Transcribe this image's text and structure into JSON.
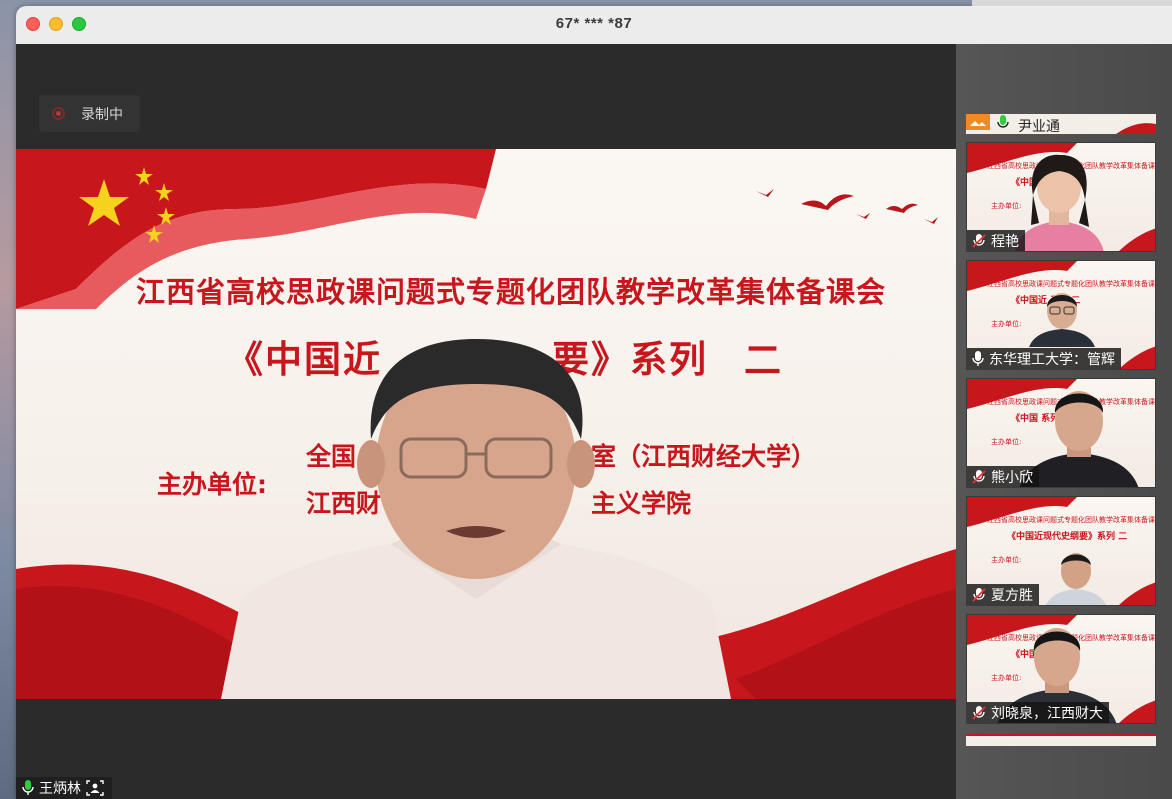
{
  "window": {
    "title": "67* *** *87"
  },
  "recording": {
    "label": "录制中"
  },
  "slide": {
    "line1": "江西省高校思政课问题式专题化团队教学改革集体备课会",
    "line2": "《中国近",
    "line2_rest": "要》系列",
    "series_number": "二",
    "sponsor_label": "主办单位:",
    "sponsor1_start": "全国",
    "sponsor1_end": "作室（江西财经大学）",
    "sponsor2_start": "江西财",
    "sponsor2_end": "主义学院"
  },
  "main_speaker": {
    "name": "王炳林"
  },
  "participants": {
    "top": {
      "name": "尹业通"
    },
    "tiles": [
      {
        "name": "程艳",
        "mini_title": "江西省高校思政课问题式专题化团队教学改革集体备课会",
        "mini_series": "《中国近 系列 二",
        "mini_sponsor": "主办单位:"
      },
      {
        "name": "东华理工大学：管辉",
        "mini_title": "江西省高校思政课问题式专题化团队教学改革集体备课会",
        "mini_series": "《中国近 系列 二",
        "mini_sponsor": "主办单位:"
      },
      {
        "name": "熊小欣",
        "mini_title": "江西省高校思政课问题式专题化团队教学改革集体备课会",
        "mini_series": "《中国 系列 二",
        "mini_sponsor": "主办单位:"
      },
      {
        "name": "夏方胜",
        "mini_title": "江西省高校思政课问题式专题化团队教学改革集体备课会",
        "mini_series": "《中国近现代史纲要》系列 二",
        "mini_sponsor": "主办单位:"
      },
      {
        "name": "刘晓泉，江西财大",
        "mini_title": "江西省高校思政课问题式专题化团队教学改革集体备课会",
        "mini_series": "《中国近 系列 二",
        "mini_sponsor": "主办单位:"
      }
    ]
  },
  "colors": {
    "brand_red": "#c8161d",
    "panel_bg": "#2b2b2b"
  },
  "icons": [
    "mic-icon",
    "record-icon",
    "speaker-view-icon",
    "image-icon"
  ]
}
